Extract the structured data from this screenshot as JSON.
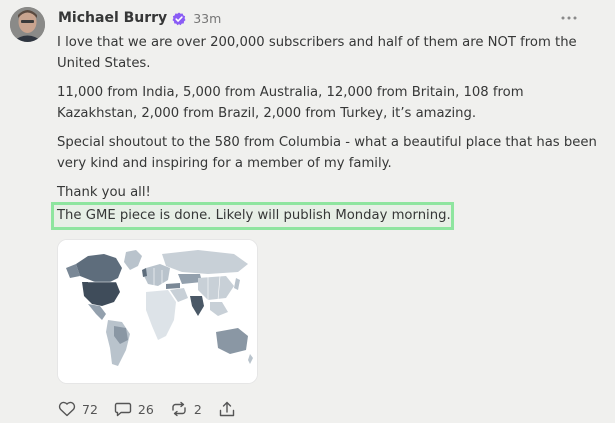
{
  "post": {
    "author": "Michael Burry",
    "timestamp": "33m",
    "paragraphs": [
      "I love that we are over 200,000 subscribers and half of them are NOT from the United States.",
      "11,000 from India, 5,000 from Australia, 12,000 from Britain, 108 from Kazakhstan, 2,000 from Brazil, 2,000 from Turkey, it’s amazing.",
      "Special shoutout to the 580 from Columbia - what a beautiful place that has been very kind and inspiring for a member of my family.",
      "Thank you all!"
    ],
    "highlighted_text": "The GME piece is done. Likely will publish Monday morning."
  },
  "actions": {
    "likes": "72",
    "comments": "26",
    "reposts": "2"
  },
  "colors": {
    "background": "#f0f0ee",
    "text": "#363737",
    "verified": "#8a5cf5",
    "highlight_border": "#8ee59f",
    "map_dark": "#5e6d7c",
    "map_light": "#b9c3cc"
  },
  "icons": [
    "verified-badge-icon",
    "more-icon",
    "heart-icon",
    "comment-icon",
    "repost-icon",
    "share-icon"
  ]
}
